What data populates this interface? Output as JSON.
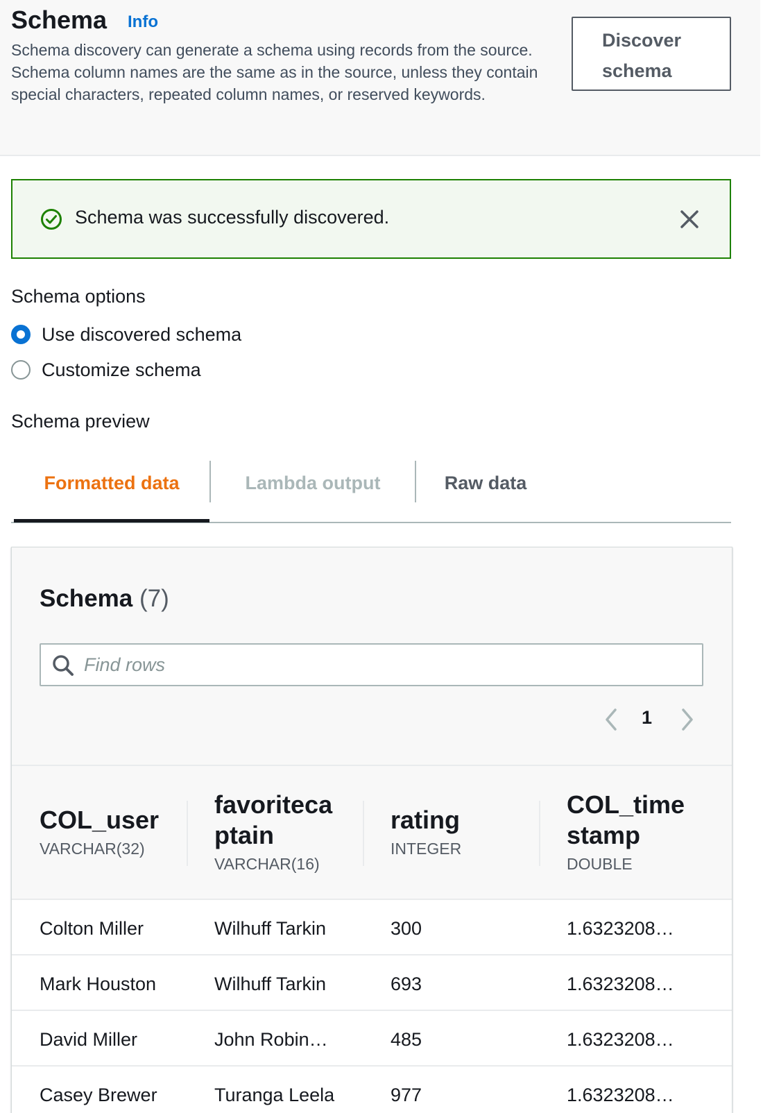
{
  "header": {
    "title": "Schema",
    "info_link": "Info",
    "description": "Schema discovery can generate a schema using records from the source. Schema column names are the same as in the source, unless they contain special characters, repeated column names, or reserved keywords.",
    "discover_button_line1": "Discover",
    "discover_button_line2": "schema"
  },
  "flash": {
    "message": "Schema was successfully discovered.",
    "status_color": "#1d8102"
  },
  "schema_options": {
    "label": "Schema options",
    "options": [
      {
        "label": "Use discovered schema",
        "selected": true
      },
      {
        "label": "Customize schema",
        "selected": false
      }
    ]
  },
  "preview": {
    "label": "Schema preview",
    "tabs": [
      {
        "label": "Formatted data",
        "state": "active"
      },
      {
        "label": "Lambda output",
        "state": "disabled"
      },
      {
        "label": "Raw data",
        "state": "normal"
      }
    ]
  },
  "table": {
    "title": "Schema",
    "count": "(7)",
    "search_placeholder": "Find rows",
    "page": "1",
    "columns": [
      {
        "name_line1": "COL_user",
        "name_line2": "",
        "type": "VARCHAR(32)"
      },
      {
        "name_line1": "favoriteca",
        "name_line2": "ptain",
        "type": "VARCHAR(16)"
      },
      {
        "name_line1": "rating",
        "name_line2": "",
        "type": "INTEGER"
      },
      {
        "name_line1": "COL_time",
        "name_line2": "stamp",
        "type": "DOUBLE"
      }
    ],
    "rows": [
      [
        "Colton Miller",
        "Wilhuff Tarkin",
        "300",
        "1.6323208…"
      ],
      [
        "Mark Houston",
        "Wilhuff Tarkin",
        "693",
        "1.6323208…"
      ],
      [
        "David Miller",
        "John Robin…",
        "485",
        "1.6323208…"
      ],
      [
        "Casey Brewer",
        "Turanga Leela",
        "977",
        "1.6323208…"
      ]
    ]
  },
  "colors": {
    "active_tab": "#ec7211",
    "link": "#0972d3",
    "success": "#1d8102",
    "radio_selected": "#0972d3"
  }
}
